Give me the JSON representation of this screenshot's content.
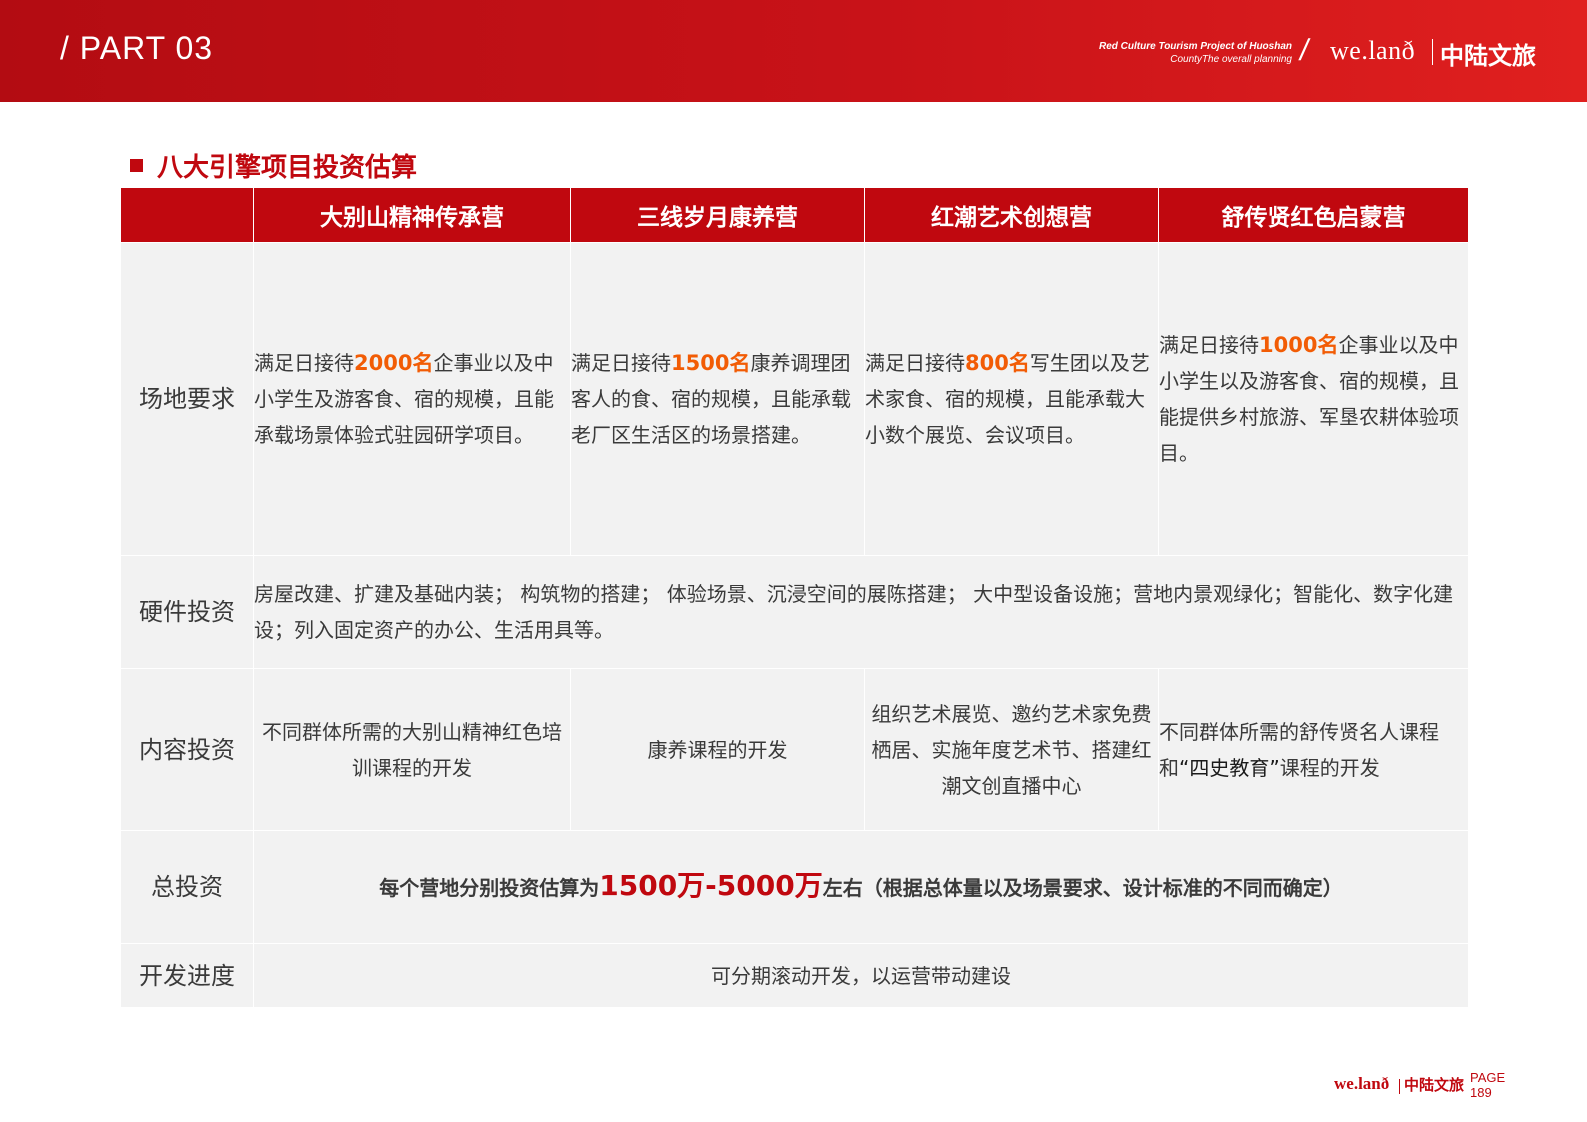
{
  "header": {
    "part_label": "/ PART 03",
    "tagline_line1": "Red Culture Tourism Project of Huoshan",
    "tagline_line2": "CountyThe overall planning",
    "slash": "/",
    "brand_logo": "we.lanð",
    "brand_cn": "中陆文旅"
  },
  "section": {
    "title": "八大引擎项目投资估算"
  },
  "table": {
    "columns": [
      "大别山精神传承营",
      "三线岁月康养营",
      "红潮艺术创想营",
      "舒传贤红色启蒙营"
    ],
    "rows": {
      "site": {
        "label": "场地要求",
        "c1": {
          "pre": "满足日接待",
          "hl": "2000名",
          "post": "企事业以及中小学生及游客食、宿的规模，且能承载场景体验式驻园研学项目。"
        },
        "c2": {
          "pre": "满足日接待",
          "hl": "1500名",
          "post": "康养调理团客人的食、宿的规模，且能承载老厂区生活区的场景搭建。"
        },
        "c3": {
          "pre": "满足日接待",
          "hl": "800名",
          "post": "写生团以及艺术家食、宿的规模，且能承载大小数个展览、会议项目。"
        },
        "c4": {
          "pre": "满足日接待",
          "hl": "1000名",
          "post": "企事业以及中小学生以及游客食、宿的规模，且能提供乡村旅游、军垦农耕体验项目。"
        }
      },
      "hardware": {
        "label": "硬件投资",
        "text": "房屋改建、扩建及基础内装； 构筑物的搭建； 体验场景、沉浸空间的展陈搭建； 大中型设备设施；营地内景观绿化；智能化、数字化建设；列入固定资产的办公、生活用具等。"
      },
      "content": {
        "label": "内容投资",
        "c1": "不同群体所需的大别山精神红色培训课程的开发",
        "c2": "康养课程的开发",
        "c3": "组织艺术展览、邀约艺术家免费栖居、实施年度艺术节、搭建红潮文创直播中心",
        "c4_pre": "不同群体所需的舒传贤名人课程和",
        "c4_hl": "“四史教育”",
        "c4_post": "课程的开发"
      },
      "total": {
        "label": "总投资",
        "pre": "每个营地分别投资估算为",
        "hl": "1500万-5000万",
        "post": "左右（根据总体量以及场景要求、设计标准的不同而确定）"
      },
      "progress": {
        "label": "开发进度",
        "text": "可分期滚动开发，以运营带动建设"
      }
    }
  },
  "footer": {
    "logo": "we.lanð",
    "cn": "中陆文旅",
    "page_label": "PAGE",
    "page_number": "189"
  },
  "colors": {
    "brand_red": "#c0080f",
    "highlight_orange": "#f25c05",
    "cell_bg": "#f2f2f2"
  }
}
